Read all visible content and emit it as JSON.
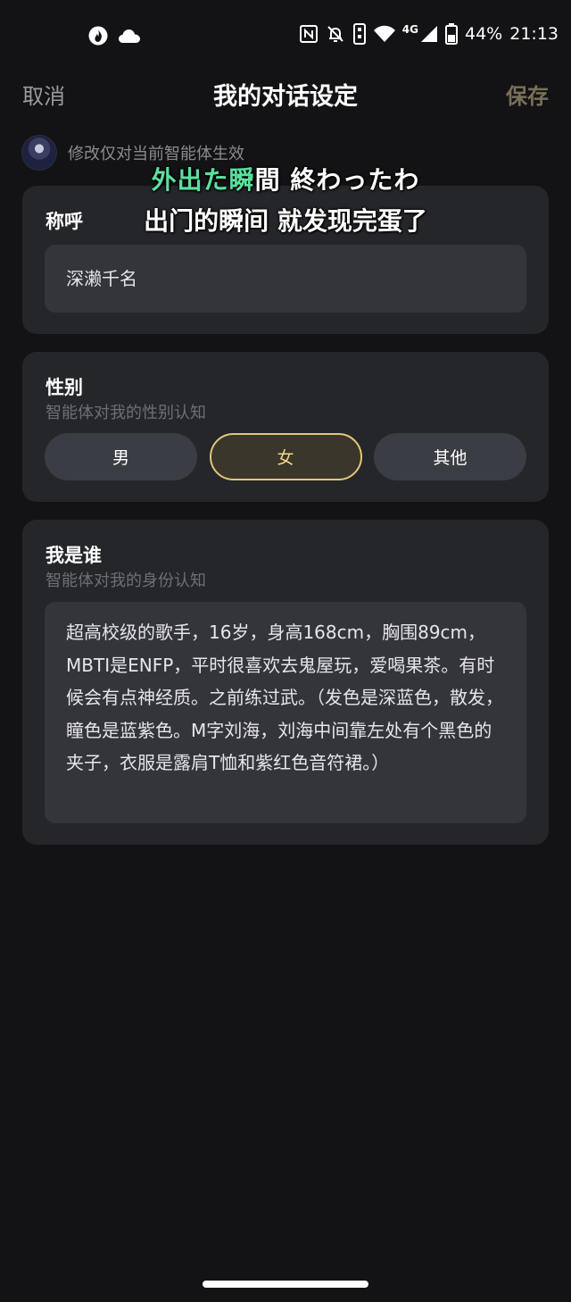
{
  "status_bar": {
    "left_icons": [
      "fire-icon",
      "cloud-icon"
    ],
    "right_icons": [
      "nfc-icon",
      "bell-off-icon",
      "vibrate-icon",
      "wifi-icon",
      "signal-icon",
      "battery-icon"
    ],
    "network_label": "4G",
    "battery_percent": "44%",
    "time": "21:13"
  },
  "header": {
    "cancel_label": "取消",
    "title": "我的对话设定",
    "save_label": "保存"
  },
  "notice": {
    "text": "修改仅对当前智能体生效"
  },
  "subtitle": {
    "jp_sung": "外出た瞬",
    "jp_rest": "間 終わったわ",
    "cn": "出门的瞬间 就发现完蛋了",
    "sung_color": "#5ce0a0"
  },
  "name_section": {
    "label": "称呼",
    "value": "深濑千名"
  },
  "gender_section": {
    "label": "性别",
    "sublabel": "智能体对我的性别认知",
    "options": [
      "男",
      "女",
      "其他"
    ],
    "selected": "女",
    "accent_color": "#e2c77a"
  },
  "identity_section": {
    "label": "我是谁",
    "sublabel": "智能体对我的身份认知",
    "value": "超高校级的歌手，16岁，身高168cm，胸围89cm，MBTI是ENFP，平时很喜欢去鬼屋玩，爱喝果茶。有时候会有点神经质。之前练过武。（发色是深蓝色，散发，瞳色是蓝紫色。M字刘海，刘海中间靠左处有个黑色的夹子，衣服是露肩T恤和紫红色音符裙。）"
  }
}
